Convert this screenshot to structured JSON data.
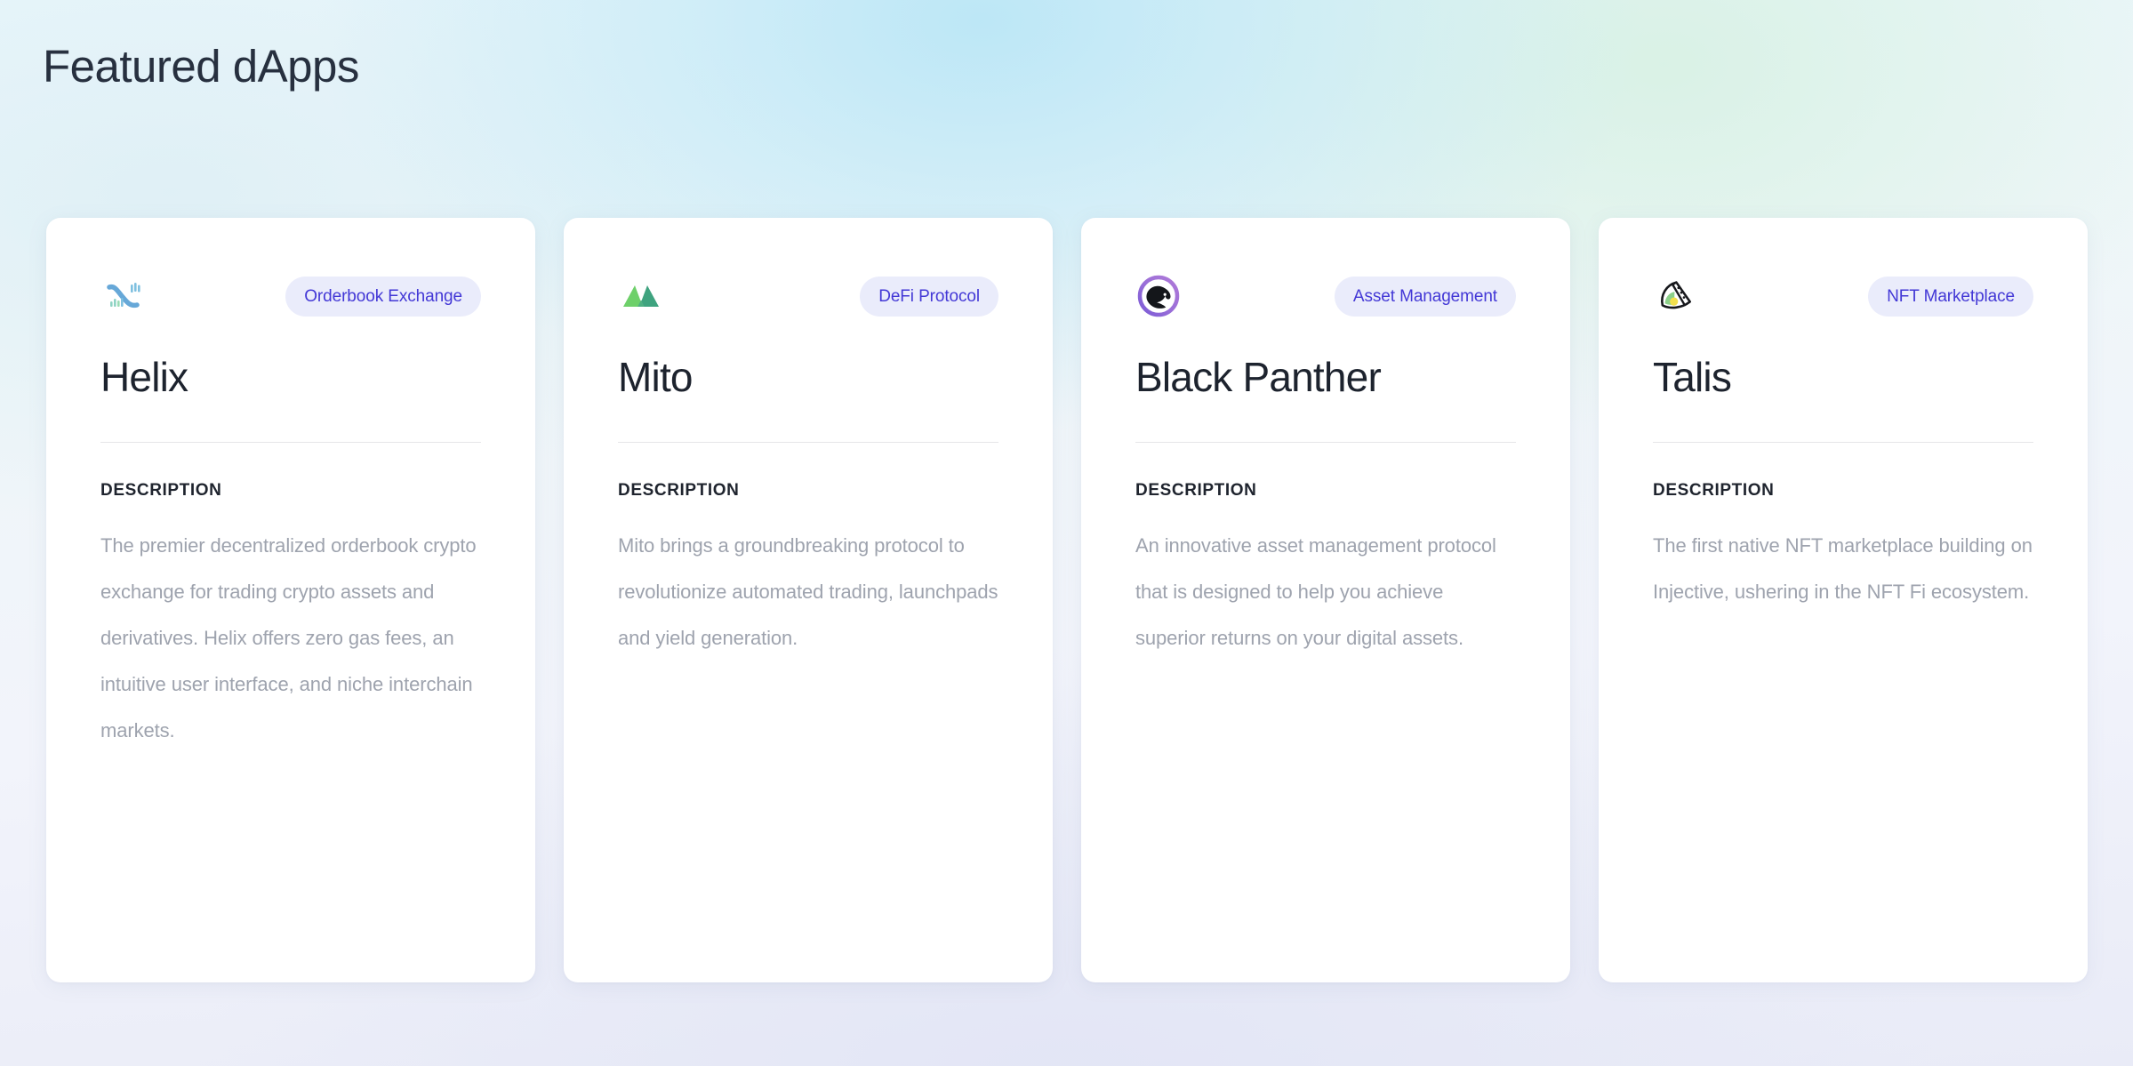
{
  "header": {
    "title": "Featured dApps"
  },
  "labels": {
    "description": "DESCRIPTION"
  },
  "colors": {
    "badge_background": "#eaecfb",
    "badge_text": "#4338d6",
    "card_background": "#ffffff",
    "title_text": "#1d232e",
    "body_text": "#9ea3ae",
    "divider": "#e6e6e8",
    "page_title_text": "#27303f"
  },
  "cards": [
    {
      "icon": "helix-logo-icon",
      "name": "Helix",
      "badge": "Orderbook Exchange",
      "description": "The premier decentralized orderbook crypto exchange for trading crypto assets and derivatives. Helix offers zero gas fees, an intuitive user interface, and niche interchain markets."
    },
    {
      "icon": "mito-logo-icon",
      "name": "Mito",
      "badge": "DeFi Protocol",
      "description": "Mito brings a groundbreaking protocol to revolutionize automated trading, launchpads and yield generation."
    },
    {
      "icon": "black-panther-logo-icon",
      "name": "Black Panther",
      "badge": "Asset Management",
      "description": "An innovative asset management protocol that is designed to help you achieve superior returns on your digital assets."
    },
    {
      "icon": "talis-logo-icon",
      "name": "Talis",
      "badge": "NFT Marketplace",
      "description": "The first native NFT marketplace building on Injective, ushering in the NFT Fi ecosystem."
    }
  ]
}
